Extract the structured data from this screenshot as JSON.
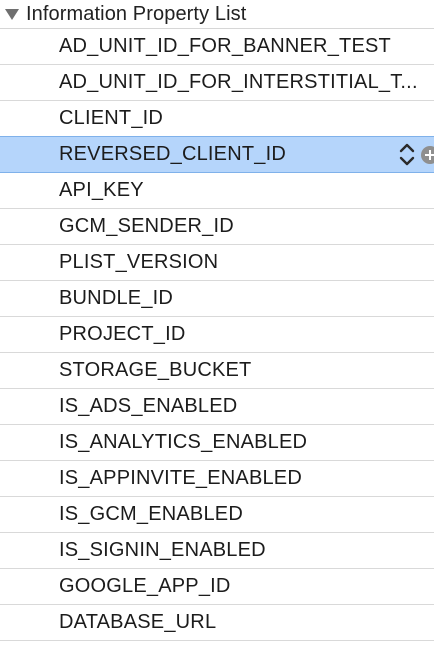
{
  "root": {
    "label": "Information Property List"
  },
  "rows": [
    {
      "key": "AD_UNIT_ID_FOR_BANNER_TEST"
    },
    {
      "key": "AD_UNIT_ID_FOR_INTERSTITIAL_T..."
    },
    {
      "key": "CLIENT_ID"
    },
    {
      "key": "REVERSED_CLIENT_ID",
      "selected": true
    },
    {
      "key": "API_KEY"
    },
    {
      "key": "GCM_SENDER_ID"
    },
    {
      "key": "PLIST_VERSION"
    },
    {
      "key": "BUNDLE_ID"
    },
    {
      "key": "PROJECT_ID"
    },
    {
      "key": "STORAGE_BUCKET"
    },
    {
      "key": "IS_ADS_ENABLED"
    },
    {
      "key": "IS_ANALYTICS_ENABLED"
    },
    {
      "key": "IS_APPINVITE_ENABLED"
    },
    {
      "key": "IS_GCM_ENABLED"
    },
    {
      "key": "IS_SIGNIN_ENABLED"
    },
    {
      "key": "GOOGLE_APP_ID"
    },
    {
      "key": "DATABASE_URL"
    }
  ],
  "icons": {
    "disclosure": "disclosure-triangle-down-icon",
    "stepper": "chevron-up-down-icon",
    "add": "add-circle-icon"
  },
  "colors": {
    "selection": "#b5d5fb",
    "selection_border": "#7fb1ea",
    "row_separator": "#d9d9d9",
    "control_gray": "#8f8f8f"
  }
}
